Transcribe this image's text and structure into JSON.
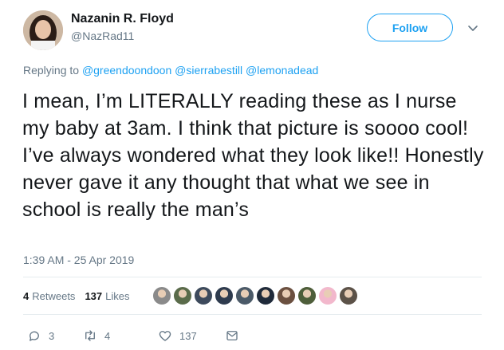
{
  "author": {
    "name": "Nazanin R. Floyd",
    "handle": "@NazRad11"
  },
  "follow_label": "Follow",
  "reply": {
    "prefix": "Replying to",
    "mentions": [
      "@greendoondoon",
      "@sierrabestill",
      "@lemonadead"
    ]
  },
  "tweet_text": "I mean, I’m LITERALLY reading these as I nurse my baby at 3am.  I think that picture is soooo cool!  I’ve always wondered what they look like!!  Honestly never gave it any thought that what we see in school is really the man’s",
  "timestamp": "1:39 AM - 25 Apr 2019",
  "stats": {
    "retweets_count": "4",
    "retweets_label": "Retweets",
    "likes_count": "137",
    "likes_label": "Likes"
  },
  "likers": [
    {
      "color": "#8a8a8a"
    },
    {
      "color": "#5a6b4a"
    },
    {
      "color": "#3d4a5c"
    },
    {
      "color": "#2e3b4e"
    },
    {
      "color": "#4b5a68"
    },
    {
      "color": "#1f2a3a"
    },
    {
      "color": "#6b5040"
    },
    {
      "color": "#4e5e3a"
    },
    {
      "color": "#f2b8cc"
    },
    {
      "color": "#5c5248"
    }
  ],
  "actions": {
    "reply_count": "3",
    "retweet_count": "4",
    "like_count": "137"
  },
  "colors": {
    "accent": "#1da1f2",
    "muted": "#657786",
    "text": "#14171a"
  },
  "icons": [
    "chevron-down-icon",
    "reply-icon",
    "retweet-icon",
    "like-icon",
    "message-icon"
  ]
}
